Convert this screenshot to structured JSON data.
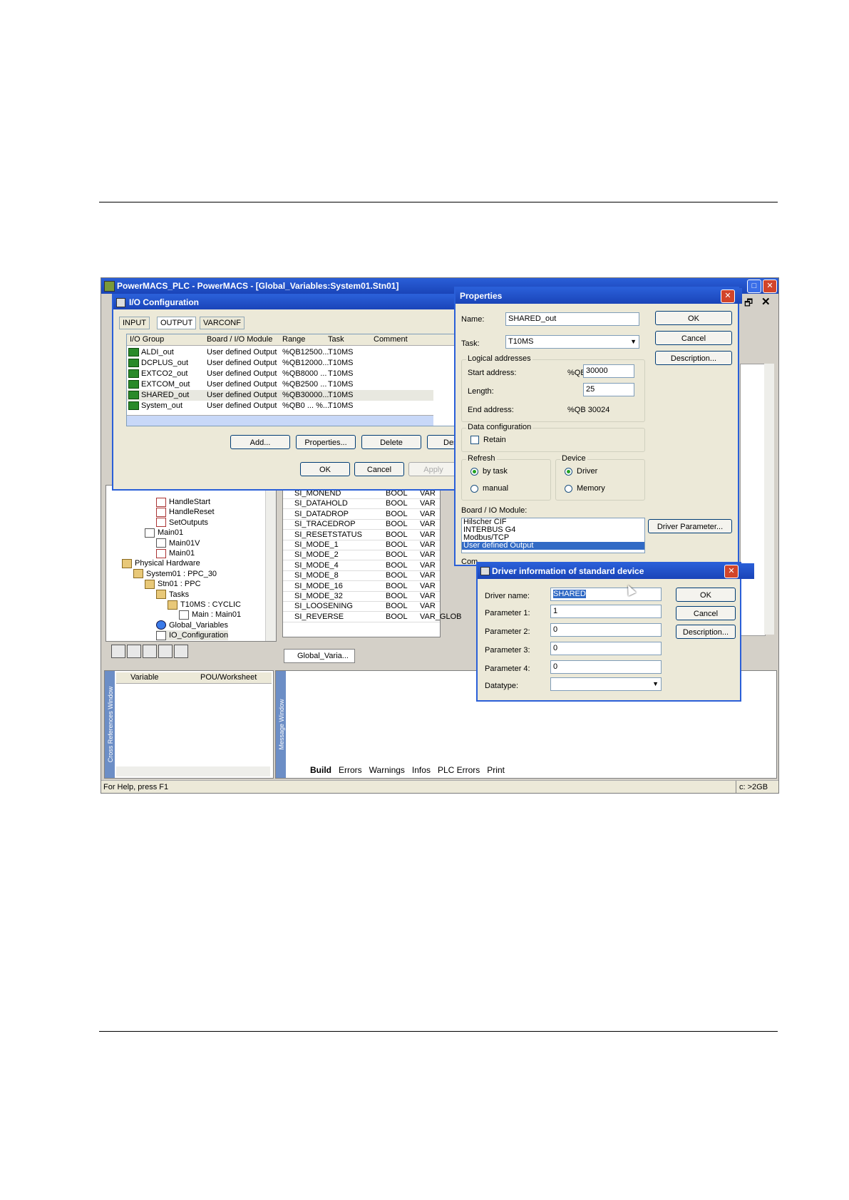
{
  "app": {
    "title": "PowerMACS_PLC - PowerMACS - [Global_Variables:System01.Stn01]",
    "status_left": "For Help, press F1",
    "status_right": "c: >2GB"
  },
  "io_config": {
    "title": "I/O Configuration",
    "tabs": [
      "INPUT",
      "OUTPUT",
      "VARCONF"
    ],
    "columns": [
      "I/O Group",
      "Board / I/O Module",
      "Range",
      "Task",
      "Comment"
    ],
    "rows": [
      {
        "group": "ALDI_out",
        "module": "User defined Output",
        "range": "%QB12500...",
        "task": "T10MS"
      },
      {
        "group": "DCPLUS_out",
        "module": "User defined Output",
        "range": "%QB12000...",
        "task": "T10MS"
      },
      {
        "group": "EXTCO2_out",
        "module": "User defined Output",
        "range": "%QB8000 ...",
        "task": "T10MS"
      },
      {
        "group": "EXTCOM_out",
        "module": "User defined Output",
        "range": "%QB2500 ...",
        "task": "T10MS"
      },
      {
        "group": "SHARED_out",
        "module": "User defined Output",
        "range": "%QB30000...",
        "task": "T10MS"
      },
      {
        "group": "System_out",
        "module": "User defined Output",
        "range": "%QB0 ... %...",
        "task": "T10MS"
      }
    ],
    "buttons": {
      "add": "Add...",
      "properties": "Properties...",
      "delete": "Delete",
      "des": "Des",
      "ok": "OK",
      "cancel": "Cancel",
      "apply": "Apply"
    }
  },
  "properties": {
    "title": "Properties",
    "name_label": "Name:",
    "name_value": "SHARED_out",
    "task_label": "Task:",
    "task_value": "T10MS",
    "logical_title": "Logical addresses",
    "start_label": "Start address:",
    "start_prefix": "%QB",
    "start_value": "30000",
    "length_label": "Length:",
    "length_value": "25",
    "end_label": "End address:",
    "end_value": "%QB  30024",
    "data_config_title": "Data configuration",
    "retain_label": "Retain",
    "refresh_title": "Refresh",
    "refresh_by_task": "by task",
    "refresh_manual": "manual",
    "device_title": "Device",
    "device_driver": "Driver",
    "device_memory": "Memory",
    "board_label": "Board / IO Module:",
    "board_items": [
      "Hilscher CIF",
      "INTERBUS G4",
      "Modbus/TCP",
      "User defined Output"
    ],
    "comment_label": "Com",
    "ok": "OK",
    "cancel": "Cancel",
    "description": "Description...",
    "driver_param": "Driver Parameter..."
  },
  "driver": {
    "title": "Driver information of standard device",
    "driver_name_label": "Driver name:",
    "driver_name_value": "SHARED",
    "p1_label": "Parameter 1:",
    "p1_value": "1",
    "p2_label": "Parameter 2:",
    "p2_value": "0",
    "p3_label": "Parameter 3:",
    "p3_value": "0",
    "p4_label": "Parameter 4:",
    "p4_value": "0",
    "datatype_label": "Datatype:",
    "ok": "OK",
    "cancel": "Cancel",
    "description": "Description..."
  },
  "tree": [
    {
      "label": "HandleStart",
      "icon": "doc",
      "indent": 4
    },
    {
      "label": "HandleReset",
      "icon": "doc",
      "indent": 4
    },
    {
      "label": "SetOutputs",
      "icon": "doc",
      "indent": 4
    },
    {
      "label": "Main01",
      "icon": "grid",
      "indent": 3
    },
    {
      "label": "Main01V",
      "icon": "grid",
      "indent": 4
    },
    {
      "label": "Main01",
      "icon": "doc",
      "indent": 4
    },
    {
      "label": "Physical Hardware",
      "icon": "fold",
      "indent": 1
    },
    {
      "label": "System01 : PPC_30",
      "icon": "fold",
      "indent": 2
    },
    {
      "label": "Stn01 : PPC",
      "icon": "fold",
      "indent": 3
    },
    {
      "label": "Tasks",
      "icon": "fold",
      "indent": 4
    },
    {
      "label": "T10MS : CYCLIC",
      "icon": "fold",
      "indent": 5
    },
    {
      "label": "Main : Main01",
      "icon": "grid",
      "indent": 6
    },
    {
      "label": "Global_Variables",
      "icon": "glob",
      "indent": 4
    },
    {
      "label": "IO_Configuration",
      "icon": "grid",
      "indent": 4
    }
  ],
  "variables": [
    {
      "name": "SI_MONEND",
      "type": "BOOL",
      "kind": "VAR"
    },
    {
      "name": "SI_DATAHOLD",
      "type": "BOOL",
      "kind": "VAR"
    },
    {
      "name": "SI_DATADROP",
      "type": "BOOL",
      "kind": "VAR"
    },
    {
      "name": "SI_TRACEDROP",
      "type": "BOOL",
      "kind": "VAR"
    },
    {
      "name": "SI_RESETSTATUS",
      "type": "BOOL",
      "kind": "VAR"
    },
    {
      "name": "SI_MODE_1",
      "type": "BOOL",
      "kind": "VAR"
    },
    {
      "name": "SI_MODE_2",
      "type": "BOOL",
      "kind": "VAR"
    },
    {
      "name": "SI_MODE_4",
      "type": "BOOL",
      "kind": "VAR"
    },
    {
      "name": "SI_MODE_8",
      "type": "BOOL",
      "kind": "VAR"
    },
    {
      "name": "SI_MODE_16",
      "type": "BOOL",
      "kind": "VAR"
    },
    {
      "name": "SI_MODE_32",
      "type": "BOOL",
      "kind": "VAR"
    },
    {
      "name": "SI_LOOSENING",
      "type": "BOOL",
      "kind": "VAR"
    },
    {
      "name": "SI_REVERSE",
      "type": "BOOL",
      "kind": "VAR_GLOB"
    }
  ],
  "worksheet_tab": "Global_Varia...",
  "cross_ref": {
    "side_label": "Cross References Window",
    "col_variable": "Variable",
    "col_pou": "POU/Worksheet"
  },
  "message": {
    "side_label": "Message Window",
    "tabs": [
      "Build",
      "Errors",
      "Warnings",
      "Infos",
      "PLC Errors",
      "Print"
    ]
  }
}
